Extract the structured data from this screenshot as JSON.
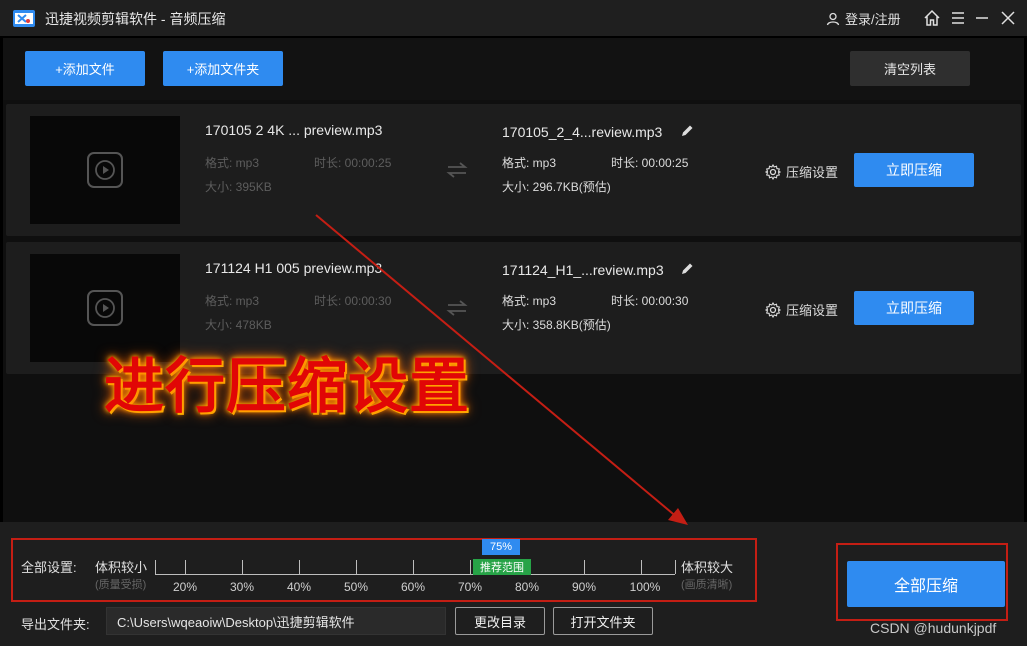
{
  "app": {
    "title": "迅捷视频剪辑软件 - 音频压缩",
    "login_label": "登录/注册"
  },
  "toolbar": {
    "add_file": "+添加文件",
    "add_folder": "+添加文件夹",
    "clear_list": "清空列表"
  },
  "files": [
    {
      "source_name": "170105 2 4K ... preview.mp3",
      "source_format": "格式: mp3",
      "source_duration": "时长: 00:00:25",
      "source_size": "大小: 395KB",
      "output_name": "170105_2_4...review.mp3",
      "output_format": "格式: mp3",
      "output_duration": "时长: 00:00:25",
      "output_size": "大小: 296.7KB(预估)",
      "settings_label": "压缩设置",
      "compress_label": "立即压缩"
    },
    {
      "source_name": "171124 H1 005 preview.mp3",
      "source_format": "格式: mp3",
      "source_duration": "时长: 00:00:30",
      "source_size": "大小: 478KB",
      "output_name": "171124_H1_...review.mp3",
      "output_format": "格式: mp3",
      "output_duration": "时长: 00:00:30",
      "output_size": "大小: 358.8KB(预估)",
      "settings_label": "压缩设置",
      "compress_label": "立即压缩"
    }
  ],
  "annotation": {
    "text": "进行压缩设置",
    "color": "#e10606"
  },
  "settings": {
    "label": "全部设置:",
    "left_label": "体积较小",
    "left_sub": "(质量受损)",
    "right_label": "体积较大",
    "right_sub": "(画质清晰)",
    "current_value": "75%",
    "current_fraction": 0.75,
    "recommend_label": "推荐范围",
    "ticks": [
      "20%",
      "30%",
      "40%",
      "50%",
      "60%",
      "70%",
      "80%",
      "90%",
      "100%"
    ]
  },
  "output": {
    "label": "导出文件夹:",
    "path": "C:\\Users\\wqeaoiw\\Desktop\\迅捷剪辑软件",
    "change_dir": "更改目录",
    "open_folder": "打开文件夹"
  },
  "compress_all": "全部压缩",
  "watermark": "CSDN @hudunkjpdf",
  "colors": {
    "accent": "#2f8bf0",
    "highlight_box": "#c41e14",
    "recommend": "#27a347"
  }
}
